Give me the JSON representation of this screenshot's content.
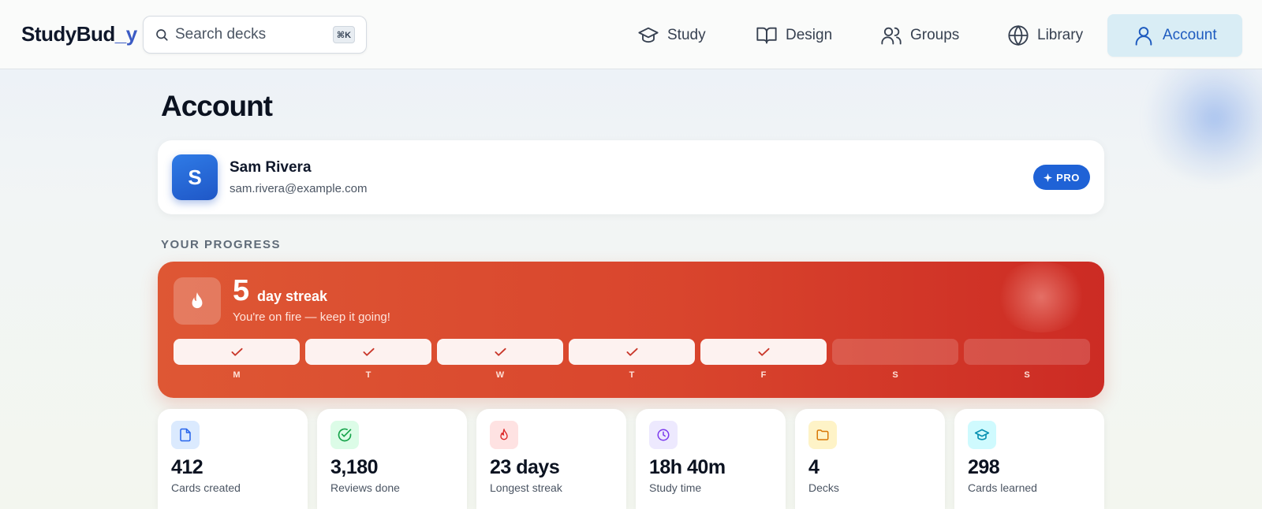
{
  "header": {
    "logo_part1": "StudyBud",
    "logo_part2": "_y",
    "search_placeholder": "Search decks",
    "search_shortcut": "⌘K",
    "nav": [
      {
        "label": "Study",
        "icon": "graduation-cap-icon"
      },
      {
        "label": "Design",
        "icon": "book-open-icon"
      },
      {
        "label": "Groups",
        "icon": "users-icon"
      },
      {
        "label": "Library",
        "icon": "globe-icon"
      },
      {
        "label": "Account",
        "icon": "user-icon",
        "active": true
      }
    ]
  },
  "page": {
    "title": "Account"
  },
  "profile": {
    "initial": "S",
    "name": "Sam Rivera",
    "email": "sam.rivera@example.com",
    "badge": "PRO"
  },
  "progress": {
    "section_label": "YOUR PROGRESS",
    "streak_count": "5",
    "streak_label": "day streak",
    "streak_message": "You're on fire — keep it going!",
    "days": [
      {
        "label": "M",
        "done": true
      },
      {
        "label": "T",
        "done": true
      },
      {
        "label": "W",
        "done": true
      },
      {
        "label": "T",
        "done": true
      },
      {
        "label": "F",
        "done": true
      },
      {
        "label": "S",
        "done": false
      },
      {
        "label": "S",
        "done": false
      }
    ]
  },
  "stats": [
    {
      "value": "412",
      "label": "Cards created",
      "icon": "document-icon",
      "color": "#2563eb",
      "bg": "#dbeafe"
    },
    {
      "value": "3,180",
      "label": "Reviews done",
      "icon": "check-circle-icon",
      "color": "#16a34a",
      "bg": "#dcfce7"
    },
    {
      "value": "23 days",
      "label": "Longest streak",
      "icon": "flame-icon",
      "color": "#dc2626",
      "bg": "#fee2e2"
    },
    {
      "value": "18h 40m",
      "label": "Study time",
      "icon": "clock-icon",
      "color": "#7c3aed",
      "bg": "#ede9fe"
    },
    {
      "value": "4",
      "label": "Decks",
      "icon": "folder-icon",
      "color": "#d97706",
      "bg": "#fef3c7"
    },
    {
      "value": "298",
      "label": "Cards learned",
      "icon": "graduation-cap-icon",
      "color": "#0891b2",
      "bg": "#cffafe"
    }
  ]
}
